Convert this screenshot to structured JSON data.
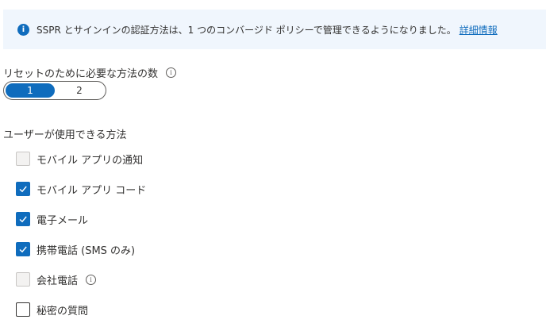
{
  "banner": {
    "icon": "info-icon",
    "text": "SSPR とサインインの認証方法は、1 つのコンバージド ポリシーで管理できるようになりました。",
    "link": "詳細情報",
    "accent": "#0f6cbd"
  },
  "reset_methods_count": {
    "label": "リセットのために必要な方法の数",
    "options": [
      "1",
      "2"
    ],
    "selected": "1"
  },
  "available_methods": {
    "label": "ユーザーが使用できる方法",
    "items": [
      {
        "label": "モバイル アプリの通知",
        "checked": false,
        "disabled": true
      },
      {
        "label": "モバイル アプリ コード",
        "checked": true,
        "disabled": false
      },
      {
        "label": "電子メール",
        "checked": true,
        "disabled": false
      },
      {
        "label": "携帯電話 (SMS のみ)",
        "checked": true,
        "disabled": false
      },
      {
        "label": "会社電話",
        "checked": false,
        "disabled": true,
        "info": true
      },
      {
        "label": "秘密の質問",
        "checked": false,
        "disabled": false
      }
    ]
  }
}
